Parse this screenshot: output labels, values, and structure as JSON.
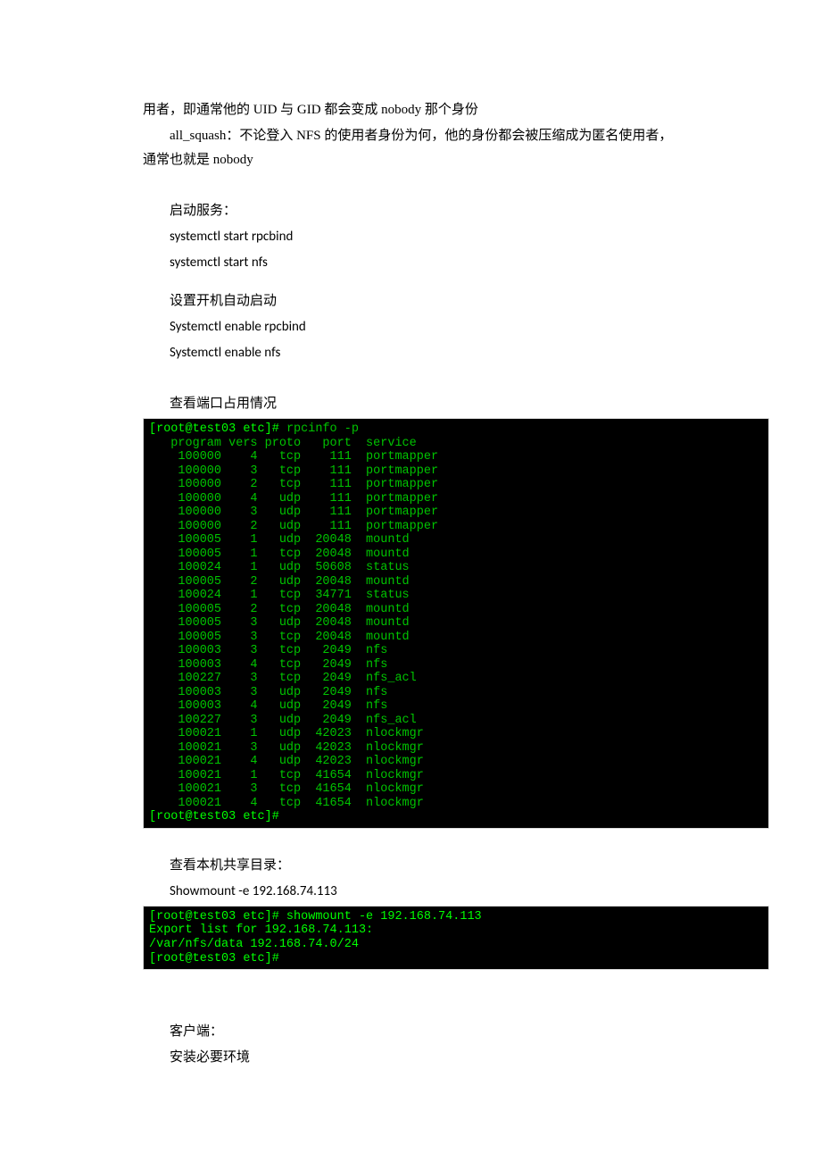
{
  "para1": "用者，即通常他的 UID 与 GID 都会变成 nobody 那个身份",
  "para2": "all_squash：不论登入 NFS 的使用者身份为何，他的身份都会被压缩成为匿名使用者，通常也就是 nobody",
  "para3": "启动服务：",
  "cmd1a": "systemctl start rpcbind",
  "cmd1b": "systemctl start nfs",
  "para4": "设置开机自动启动",
  "cmd2a": "Systemctl enable rpcbind",
  "cmd2b": "Systemctl enable nfs",
  "para5": "查看端口占用情况",
  "term1_prompt1": "[root@test03 etc]# ",
  "term1_cmd": "rpcinfo -p",
  "term1_header": "   program vers proto   port  service",
  "term1_rows": [
    [
      "100000",
      "4",
      "tcp",
      "111",
      "portmapper"
    ],
    [
      "100000",
      "3",
      "tcp",
      "111",
      "portmapper"
    ],
    [
      "100000",
      "2",
      "tcp",
      "111",
      "portmapper"
    ],
    [
      "100000",
      "4",
      "udp",
      "111",
      "portmapper"
    ],
    [
      "100000",
      "3",
      "udp",
      "111",
      "portmapper"
    ],
    [
      "100000",
      "2",
      "udp",
      "111",
      "portmapper"
    ],
    [
      "100005",
      "1",
      "udp",
      "20048",
      "mountd"
    ],
    [
      "100005",
      "1",
      "tcp",
      "20048",
      "mountd"
    ],
    [
      "100024",
      "1",
      "udp",
      "50608",
      "status"
    ],
    [
      "100005",
      "2",
      "udp",
      "20048",
      "mountd"
    ],
    [
      "100024",
      "1",
      "tcp",
      "34771",
      "status"
    ],
    [
      "100005",
      "2",
      "tcp",
      "20048",
      "mountd"
    ],
    [
      "100005",
      "3",
      "udp",
      "20048",
      "mountd"
    ],
    [
      "100005",
      "3",
      "tcp",
      "20048",
      "mountd"
    ],
    [
      "100003",
      "3",
      "tcp",
      "2049",
      "nfs"
    ],
    [
      "100003",
      "4",
      "tcp",
      "2049",
      "nfs"
    ],
    [
      "100227",
      "3",
      "tcp",
      "2049",
      "nfs_acl"
    ],
    [
      "100003",
      "3",
      "udp",
      "2049",
      "nfs"
    ],
    [
      "100003",
      "4",
      "udp",
      "2049",
      "nfs"
    ],
    [
      "100227",
      "3",
      "udp",
      "2049",
      "nfs_acl"
    ],
    [
      "100021",
      "1",
      "udp",
      "42023",
      "nlockmgr"
    ],
    [
      "100021",
      "3",
      "udp",
      "42023",
      "nlockmgr"
    ],
    [
      "100021",
      "4",
      "udp",
      "42023",
      "nlockmgr"
    ],
    [
      "100021",
      "1",
      "tcp",
      "41654",
      "nlockmgr"
    ],
    [
      "100021",
      "3",
      "tcp",
      "41654",
      "nlockmgr"
    ],
    [
      "100021",
      "4",
      "tcp",
      "41654",
      "nlockmgr"
    ]
  ],
  "term1_prompt2": "[root@test03 etc]# ",
  "para6": "查看本机共享目录：",
  "cmd3": "Showmount -e 192.168.74.113",
  "term2_line1_prompt": "[root@test03 etc]# ",
  "term2_line1_cmd": "showmount -e 192.168.74.113",
  "term2_line2": "Export list for 192.168.74.113:",
  "term2_line3": "/var/nfs/data 192.168.74.0/24",
  "term2_line4": "[root@test03 etc]# ",
  "para7": "客户端：",
  "para8": "安装必要环境"
}
